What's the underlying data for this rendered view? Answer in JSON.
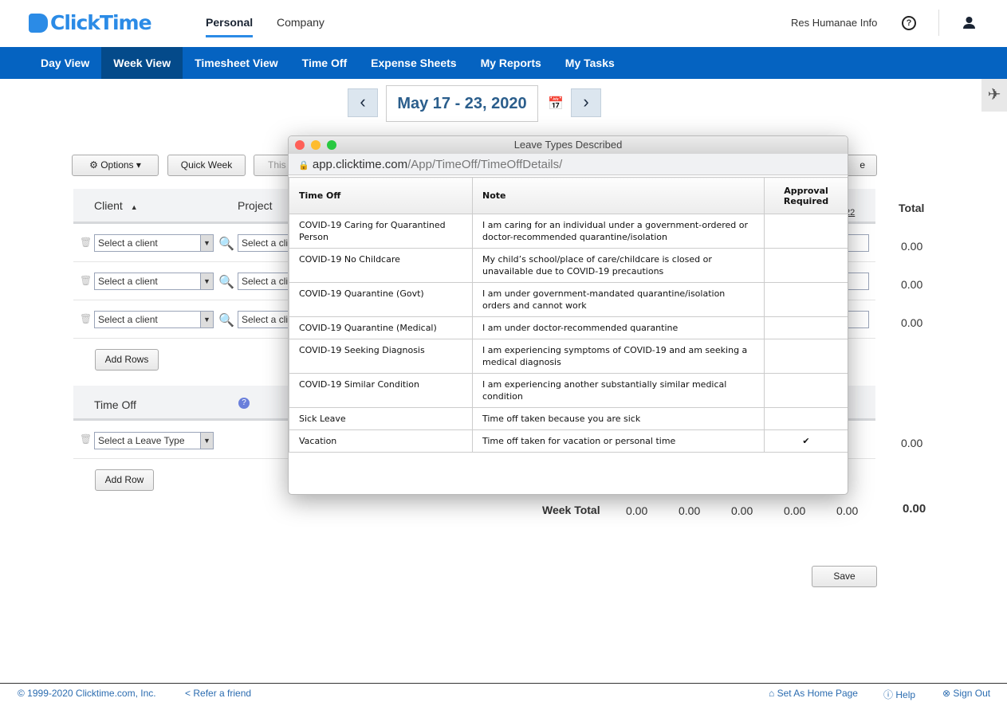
{
  "brand": "ClickTime",
  "top_tabs": {
    "personal": "Personal",
    "company": "Company"
  },
  "user": "Res Humanae Info",
  "nav": [
    "Day View",
    "Week View",
    "Timesheet View",
    "Time Off",
    "Expense Sheets",
    "My Reports",
    "My Tasks"
  ],
  "nav_active": "Week View",
  "date_range": "May 17 - 23, 2020",
  "toolbar": {
    "options": "Options",
    "quick_week": "Quick Week",
    "this_week": "This",
    "right_button": "e"
  },
  "grid": {
    "client_header": "Client",
    "project_header": "Project",
    "date_header": "22",
    "total_header": "Total",
    "client_placeholder": "Select a client",
    "project_placeholder": "Select a cli",
    "row_totals": [
      "0.00",
      "0.00",
      "0.00"
    ],
    "add_rows": "Add Rows",
    "time_off_header": "Time Off",
    "leave_placeholder": "Select a Leave Type",
    "time_off_total": "0.00",
    "add_row": "Add Row",
    "week_total_label": "Week Total",
    "week_totals": [
      "0.00",
      "0.00",
      "0.00",
      "0.00",
      "0.00"
    ],
    "grand_total": "0.00",
    "save": "Save"
  },
  "popup": {
    "title": "Leave Types Described",
    "url_domain": "app.clicktime.com",
    "url_path": "/App/TimeOff/TimeOffDetails/",
    "columns": [
      "Time Off",
      "Note",
      "Approval Required"
    ],
    "rows": [
      {
        "type": "COVID-19 Caring for Quarantined Person",
        "note": "I am caring for an individual under a government-ordered or doctor-recommended quarantine/isolation",
        "approval": ""
      },
      {
        "type": "COVID-19 No Childcare",
        "note": "My child’s school/place of care/childcare is closed or unavailable due to COVID-19 precautions",
        "approval": ""
      },
      {
        "type": "COVID-19 Quarantine (Govt)",
        "note": "I am under government-mandated quarantine/isolation orders and cannot work",
        "approval": ""
      },
      {
        "type": "COVID-19 Quarantine (Medical)",
        "note": "I am under doctor-recommended quarantine",
        "approval": ""
      },
      {
        "type": "COVID-19 Seeking Diagnosis",
        "note": "I am experiencing symptoms of COVID-19 and am seeking a medical diagnosis",
        "approval": ""
      },
      {
        "type": "COVID-19 Similar Condition",
        "note": "I am experiencing another substantially similar medical condition",
        "approval": ""
      },
      {
        "type": "Sick Leave",
        "note": "Time off taken because you are sick",
        "approval": ""
      },
      {
        "type": "Vacation",
        "note": "Time off taken for vacation or personal time",
        "approval": "✔"
      }
    ]
  },
  "footer": {
    "copyright": "© 1999-2020 Clicktime.com, Inc.",
    "refer": "Refer a friend",
    "home": "Set As Home Page",
    "help": "Help",
    "signout": "Sign Out"
  },
  "colors": {
    "nav": "#0563c1",
    "nav_active": "#044a8a",
    "brand": "#2b8be6"
  }
}
